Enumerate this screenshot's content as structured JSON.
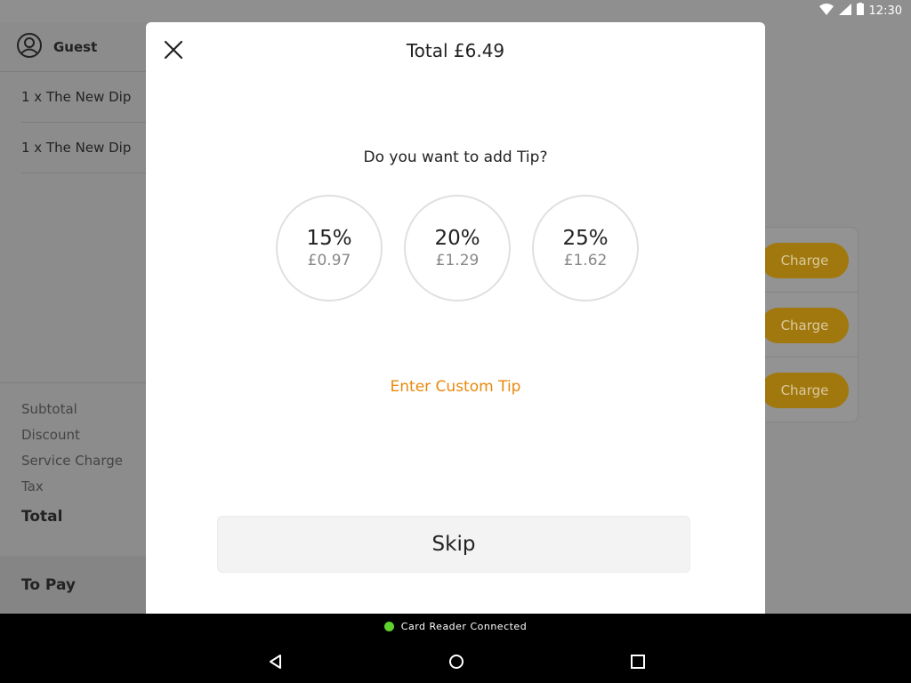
{
  "status_bar": {
    "time": "12:30"
  },
  "order_panel": {
    "customer": "Guest",
    "items": [
      "1 x The New Dip",
      "1 x The New Dip"
    ],
    "summary_labels": [
      "Subtotal",
      "Discount",
      "Service Charge",
      "Tax"
    ],
    "total_label": "Total",
    "to_pay_label": "To Pay"
  },
  "payment_options": {
    "charge_labels": [
      "Charge",
      "Charge",
      "Charge"
    ]
  },
  "tip_dialog": {
    "title": "Total £6.49",
    "question": "Do you want to add Tip?",
    "options": [
      {
        "percent": "15%",
        "amount": "£0.97"
      },
      {
        "percent": "20%",
        "amount": "£1.29"
      },
      {
        "percent": "25%",
        "amount": "£1.62"
      }
    ],
    "custom_tip_label": "Enter Custom Tip",
    "skip_label": "Skip"
  },
  "footer": {
    "reader_status": "Card Reader Connected"
  },
  "colors": {
    "accent": "#e8890c",
    "charge_button": "#a0780d",
    "reader_dot": "#5fd230"
  }
}
